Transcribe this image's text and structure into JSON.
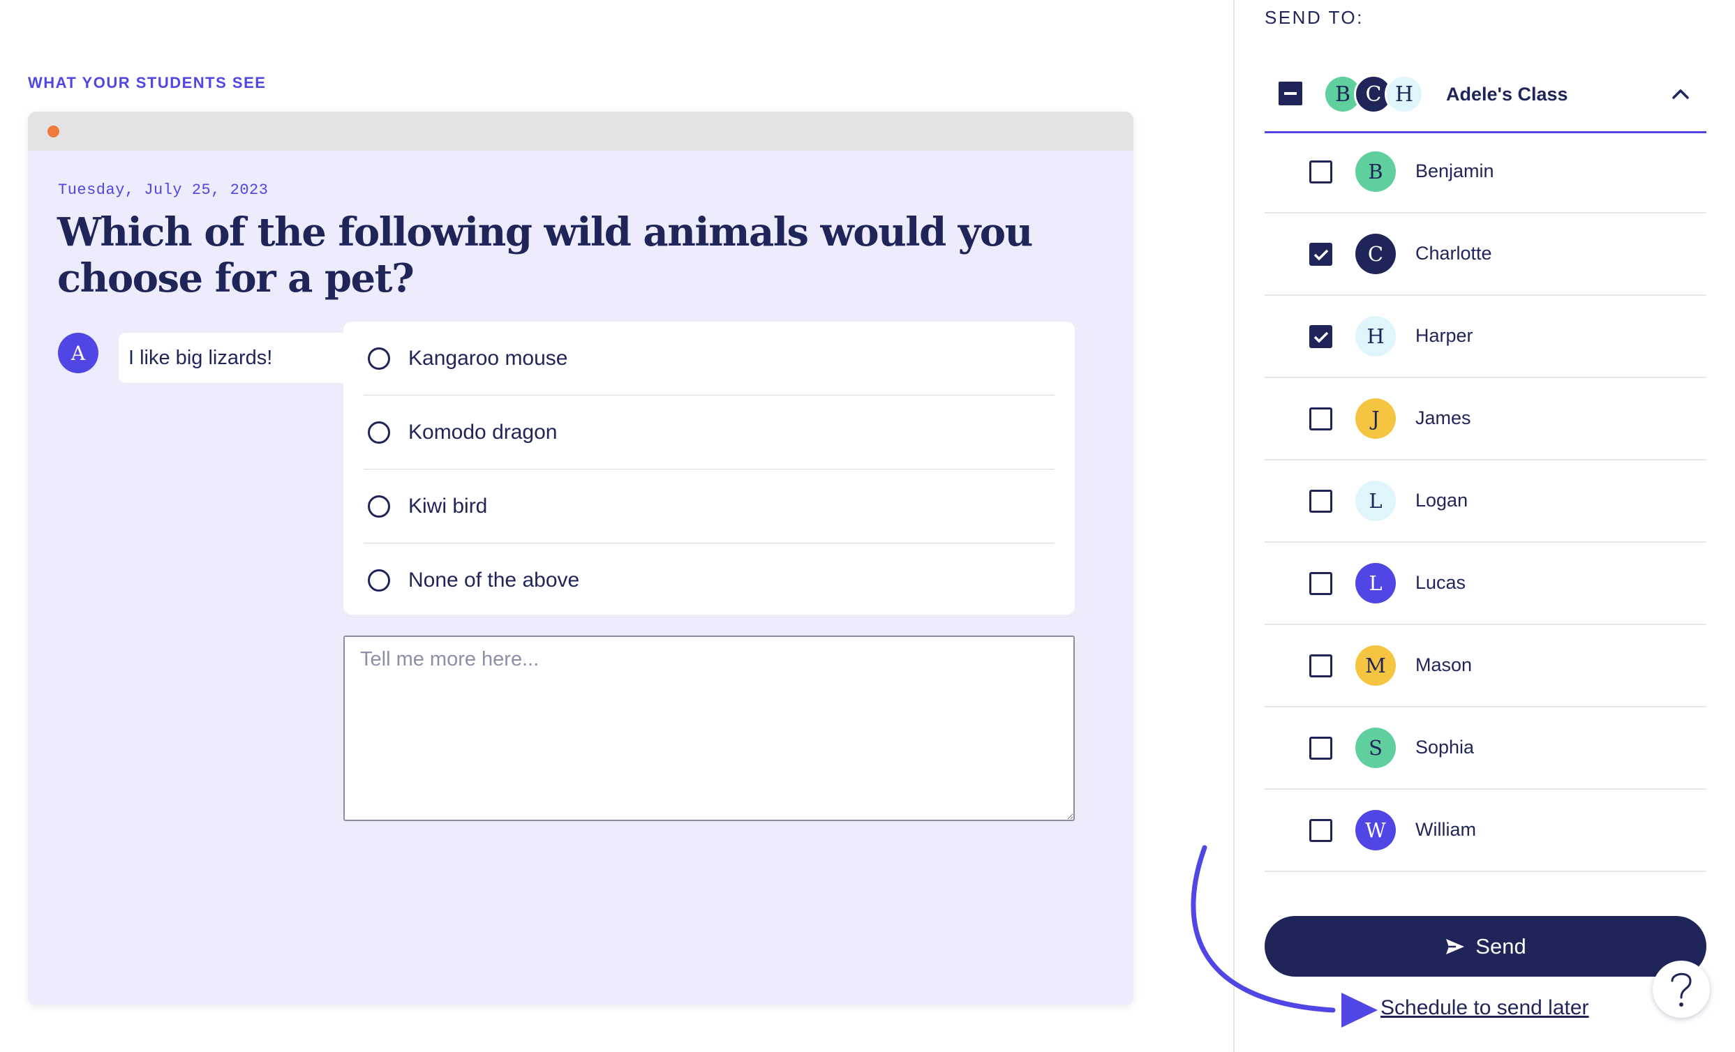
{
  "preview": {
    "heading": "WHAT YOUR STUDENTS SEE",
    "date": "Tuesday, July 25, 2023",
    "question": "Which of the following wild animals would you choose for a pet?",
    "author_initial": "A",
    "answer": "I like big lizards!",
    "choices": [
      {
        "label": "Kangaroo mouse"
      },
      {
        "label": "Komodo dragon"
      },
      {
        "label": "Kiwi bird"
      },
      {
        "label": "None of the above"
      }
    ],
    "more_placeholder": "Tell me more here..."
  },
  "send_panel": {
    "label": "SEND TO:",
    "class_name": "Adele's Class",
    "class_avatars": [
      {
        "initial": "B",
        "bg": "#5fcf9e",
        "fg": "#1f2558"
      },
      {
        "initial": "C",
        "bg": "#1f2558",
        "fg": "#ffffff"
      },
      {
        "initial": "H",
        "bg": "#dff4fb",
        "fg": "#1f2558"
      }
    ],
    "students": [
      {
        "initial": "B",
        "name": "Benjamin",
        "checked": false,
        "bg": "#5fcf9e",
        "fg": "#1f2558"
      },
      {
        "initial": "C",
        "name": "Charlotte",
        "checked": true,
        "bg": "#1f2558",
        "fg": "#ffffff"
      },
      {
        "initial": "H",
        "name": "Harper",
        "checked": true,
        "bg": "#dff4fb",
        "fg": "#1f2558"
      },
      {
        "initial": "J",
        "name": "James",
        "checked": false,
        "bg": "#f5c542",
        "fg": "#1f2558"
      },
      {
        "initial": "L",
        "name": "Logan",
        "checked": false,
        "bg": "#dff4fb",
        "fg": "#1f2558"
      },
      {
        "initial": "L",
        "name": "Lucas",
        "checked": false,
        "bg": "#4f46e5",
        "fg": "#ffffff"
      },
      {
        "initial": "M",
        "name": "Mason",
        "checked": false,
        "bg": "#f5c542",
        "fg": "#1f2558"
      },
      {
        "initial": "S",
        "name": "Sophia",
        "checked": false,
        "bg": "#5fcf9e",
        "fg": "#1f2558"
      },
      {
        "initial": "W",
        "name": "William",
        "checked": false,
        "bg": "#4f46e5",
        "fg": "#ffffff"
      }
    ],
    "send_label": "Send",
    "send_icon": "send-icon",
    "schedule_label": "Schedule to send later",
    "help_icon": "question-icon"
  },
  "colors": {
    "primary": "#1f2558",
    "accent": "#4f46e5",
    "preview_bg": "#ececfc"
  }
}
